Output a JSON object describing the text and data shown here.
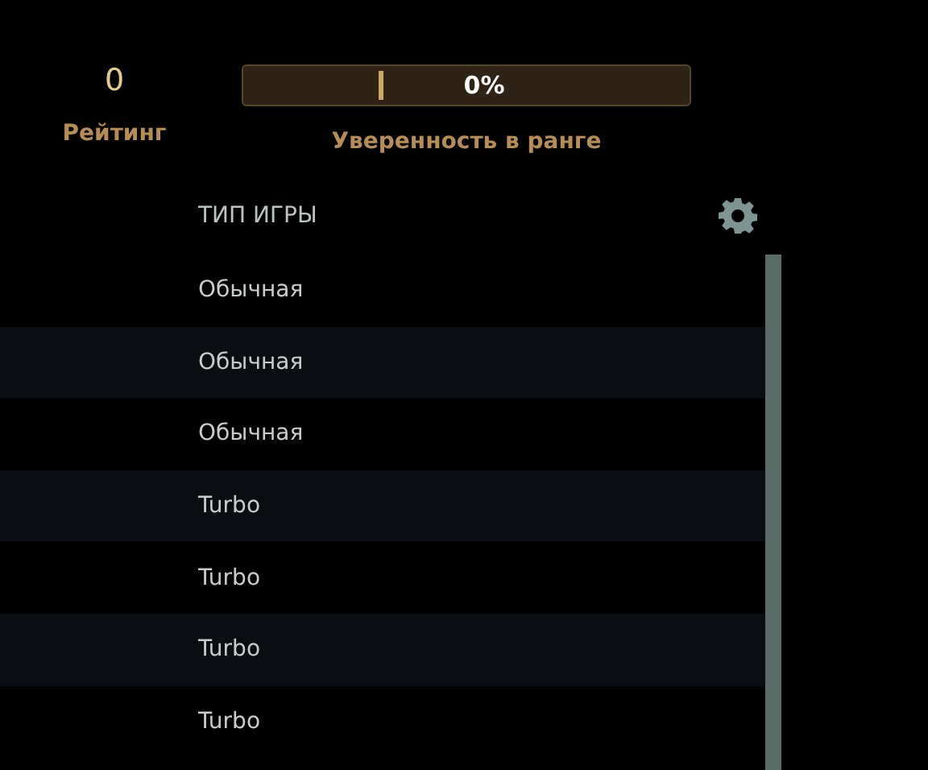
{
  "rating": {
    "value": "0",
    "label": "Рейтинг"
  },
  "confidence": {
    "level": 0,
    "reading": "0%",
    "label": "Уверенность в ранге"
  },
  "table": {
    "columns": [
      "ТИП ИГРЫ"
    ],
    "rows": [
      {
        "game_type": "Обычная"
      },
      {
        "game_type": "Обычная"
      },
      {
        "game_type": "Обычная"
      },
      {
        "game_type": "Turbo"
      },
      {
        "game_type": "Turbo"
      },
      {
        "game_type": "Turbo"
      },
      {
        "game_type": "Turbo"
      }
    ]
  }
}
